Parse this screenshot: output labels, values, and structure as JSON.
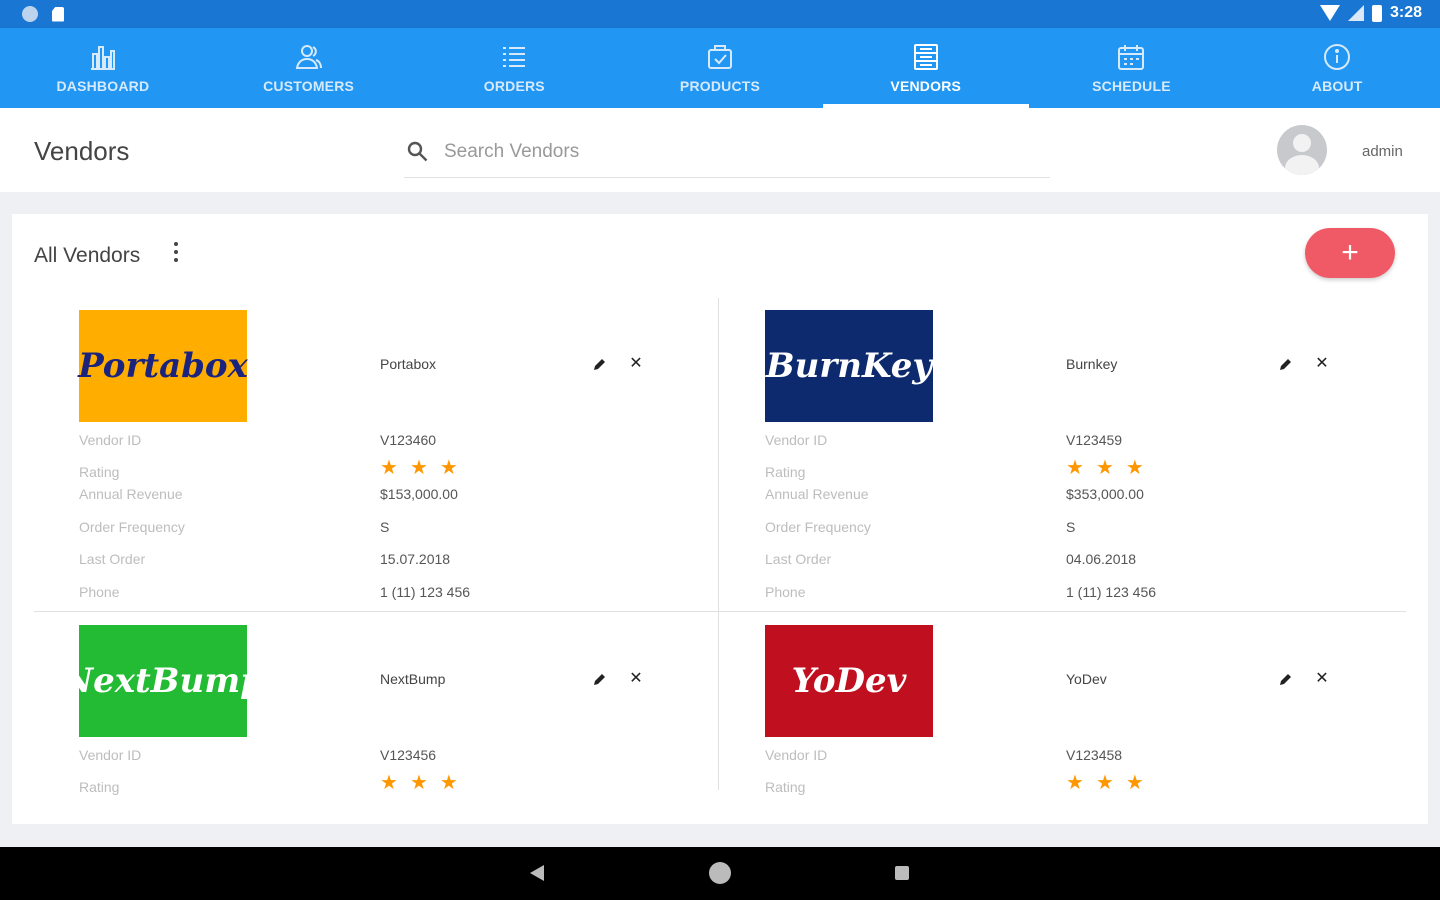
{
  "status_bar": {
    "time": "3:28"
  },
  "nav": {
    "tabs": [
      {
        "label": "DASHBOARD",
        "icon": "bar-chart-icon"
      },
      {
        "label": "CUSTOMERS",
        "icon": "people-icon"
      },
      {
        "label": "ORDERS",
        "icon": "list-icon"
      },
      {
        "label": "PRODUCTS",
        "icon": "package-icon"
      },
      {
        "label": "VENDORS",
        "icon": "vendor-icon"
      },
      {
        "label": "SCHEDULE",
        "icon": "calendar-icon"
      },
      {
        "label": "ABOUT",
        "icon": "info-icon"
      }
    ],
    "active": "VENDORS"
  },
  "header": {
    "title": "Vendors",
    "search_placeholder": "Search Vendors",
    "user": "admin"
  },
  "card": {
    "title": "All Vendors",
    "add_label": "+"
  },
  "labels": {
    "vendor_id": "Vendor ID",
    "rating": "Rating",
    "annual_revenue": "Annual Revenue",
    "order_frequency": "Order Frequency",
    "last_order": "Last Order",
    "phone": "Phone"
  },
  "vendors": [
    {
      "name": "Portabox",
      "logo_text": "Portabox",
      "logo_bg": "#ffae00",
      "logo_fg": "#1a237e",
      "id": "V123460",
      "rating": 3,
      "revenue": "$153,000.00",
      "frequency": "S",
      "last_order": "15.07.2018",
      "phone": "1 (11) 123 456"
    },
    {
      "name": "Burnkey",
      "logo_text": "BurnKey",
      "logo_bg": "#0d2a6e",
      "logo_fg": "#ffffff",
      "id": "V123459",
      "rating": 3,
      "revenue": "$353,000.00",
      "frequency": "S",
      "last_order": "04.06.2018",
      "phone": "1 (11) 123 456"
    },
    {
      "name": "NextBump",
      "logo_text": "NextBump",
      "logo_bg": "#22bb33",
      "logo_fg": "#ffffff",
      "id": "V123456",
      "rating": 3,
      "revenue": "",
      "frequency": "",
      "last_order": "",
      "phone": ""
    },
    {
      "name": "YoDev",
      "logo_text": "YoDev",
      "logo_bg": "#c0101f",
      "logo_fg": "#ffffff",
      "id": "V123458",
      "rating": 3,
      "revenue": "",
      "frequency": "",
      "last_order": "",
      "phone": ""
    }
  ],
  "colors": {
    "primary": "#2196f3",
    "status_bar": "#1976d2",
    "accent": "#ef5a66",
    "star": "#ff9800"
  }
}
